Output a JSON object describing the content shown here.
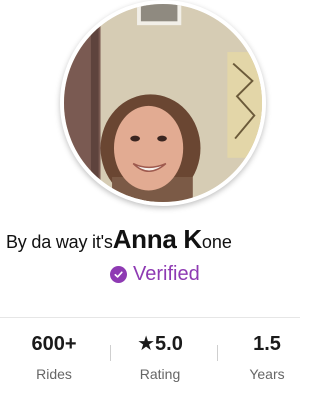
{
  "profile": {
    "name_prefix": "By da way it's",
    "name_main": "Anna K",
    "name_suffix": "one",
    "avatar_icon": "profile-photo",
    "verified": {
      "label": "Verified",
      "icon": "check-badge-icon",
      "color": "#8e3ab3"
    }
  },
  "stats": [
    {
      "value": "600+",
      "label": "Rides"
    },
    {
      "value": "★5.0",
      "label": "Rating"
    },
    {
      "value": "1.5",
      "label": "Years"
    }
  ]
}
